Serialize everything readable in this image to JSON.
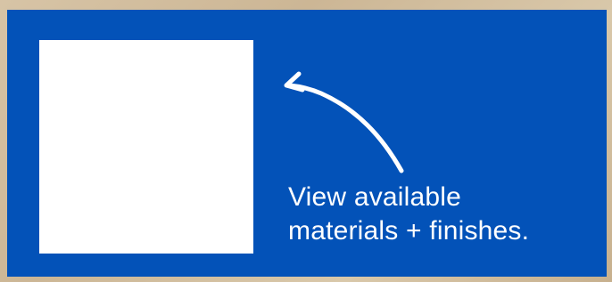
{
  "colors": {
    "card_background": "#0352b8",
    "placeholder": "#ffffff",
    "text": "#ffffff",
    "arrow": "#ffffff"
  },
  "caption": {
    "line1": "View available",
    "line2": "materials + finishes."
  },
  "arrow_icon": "curved-arrow-up-left"
}
